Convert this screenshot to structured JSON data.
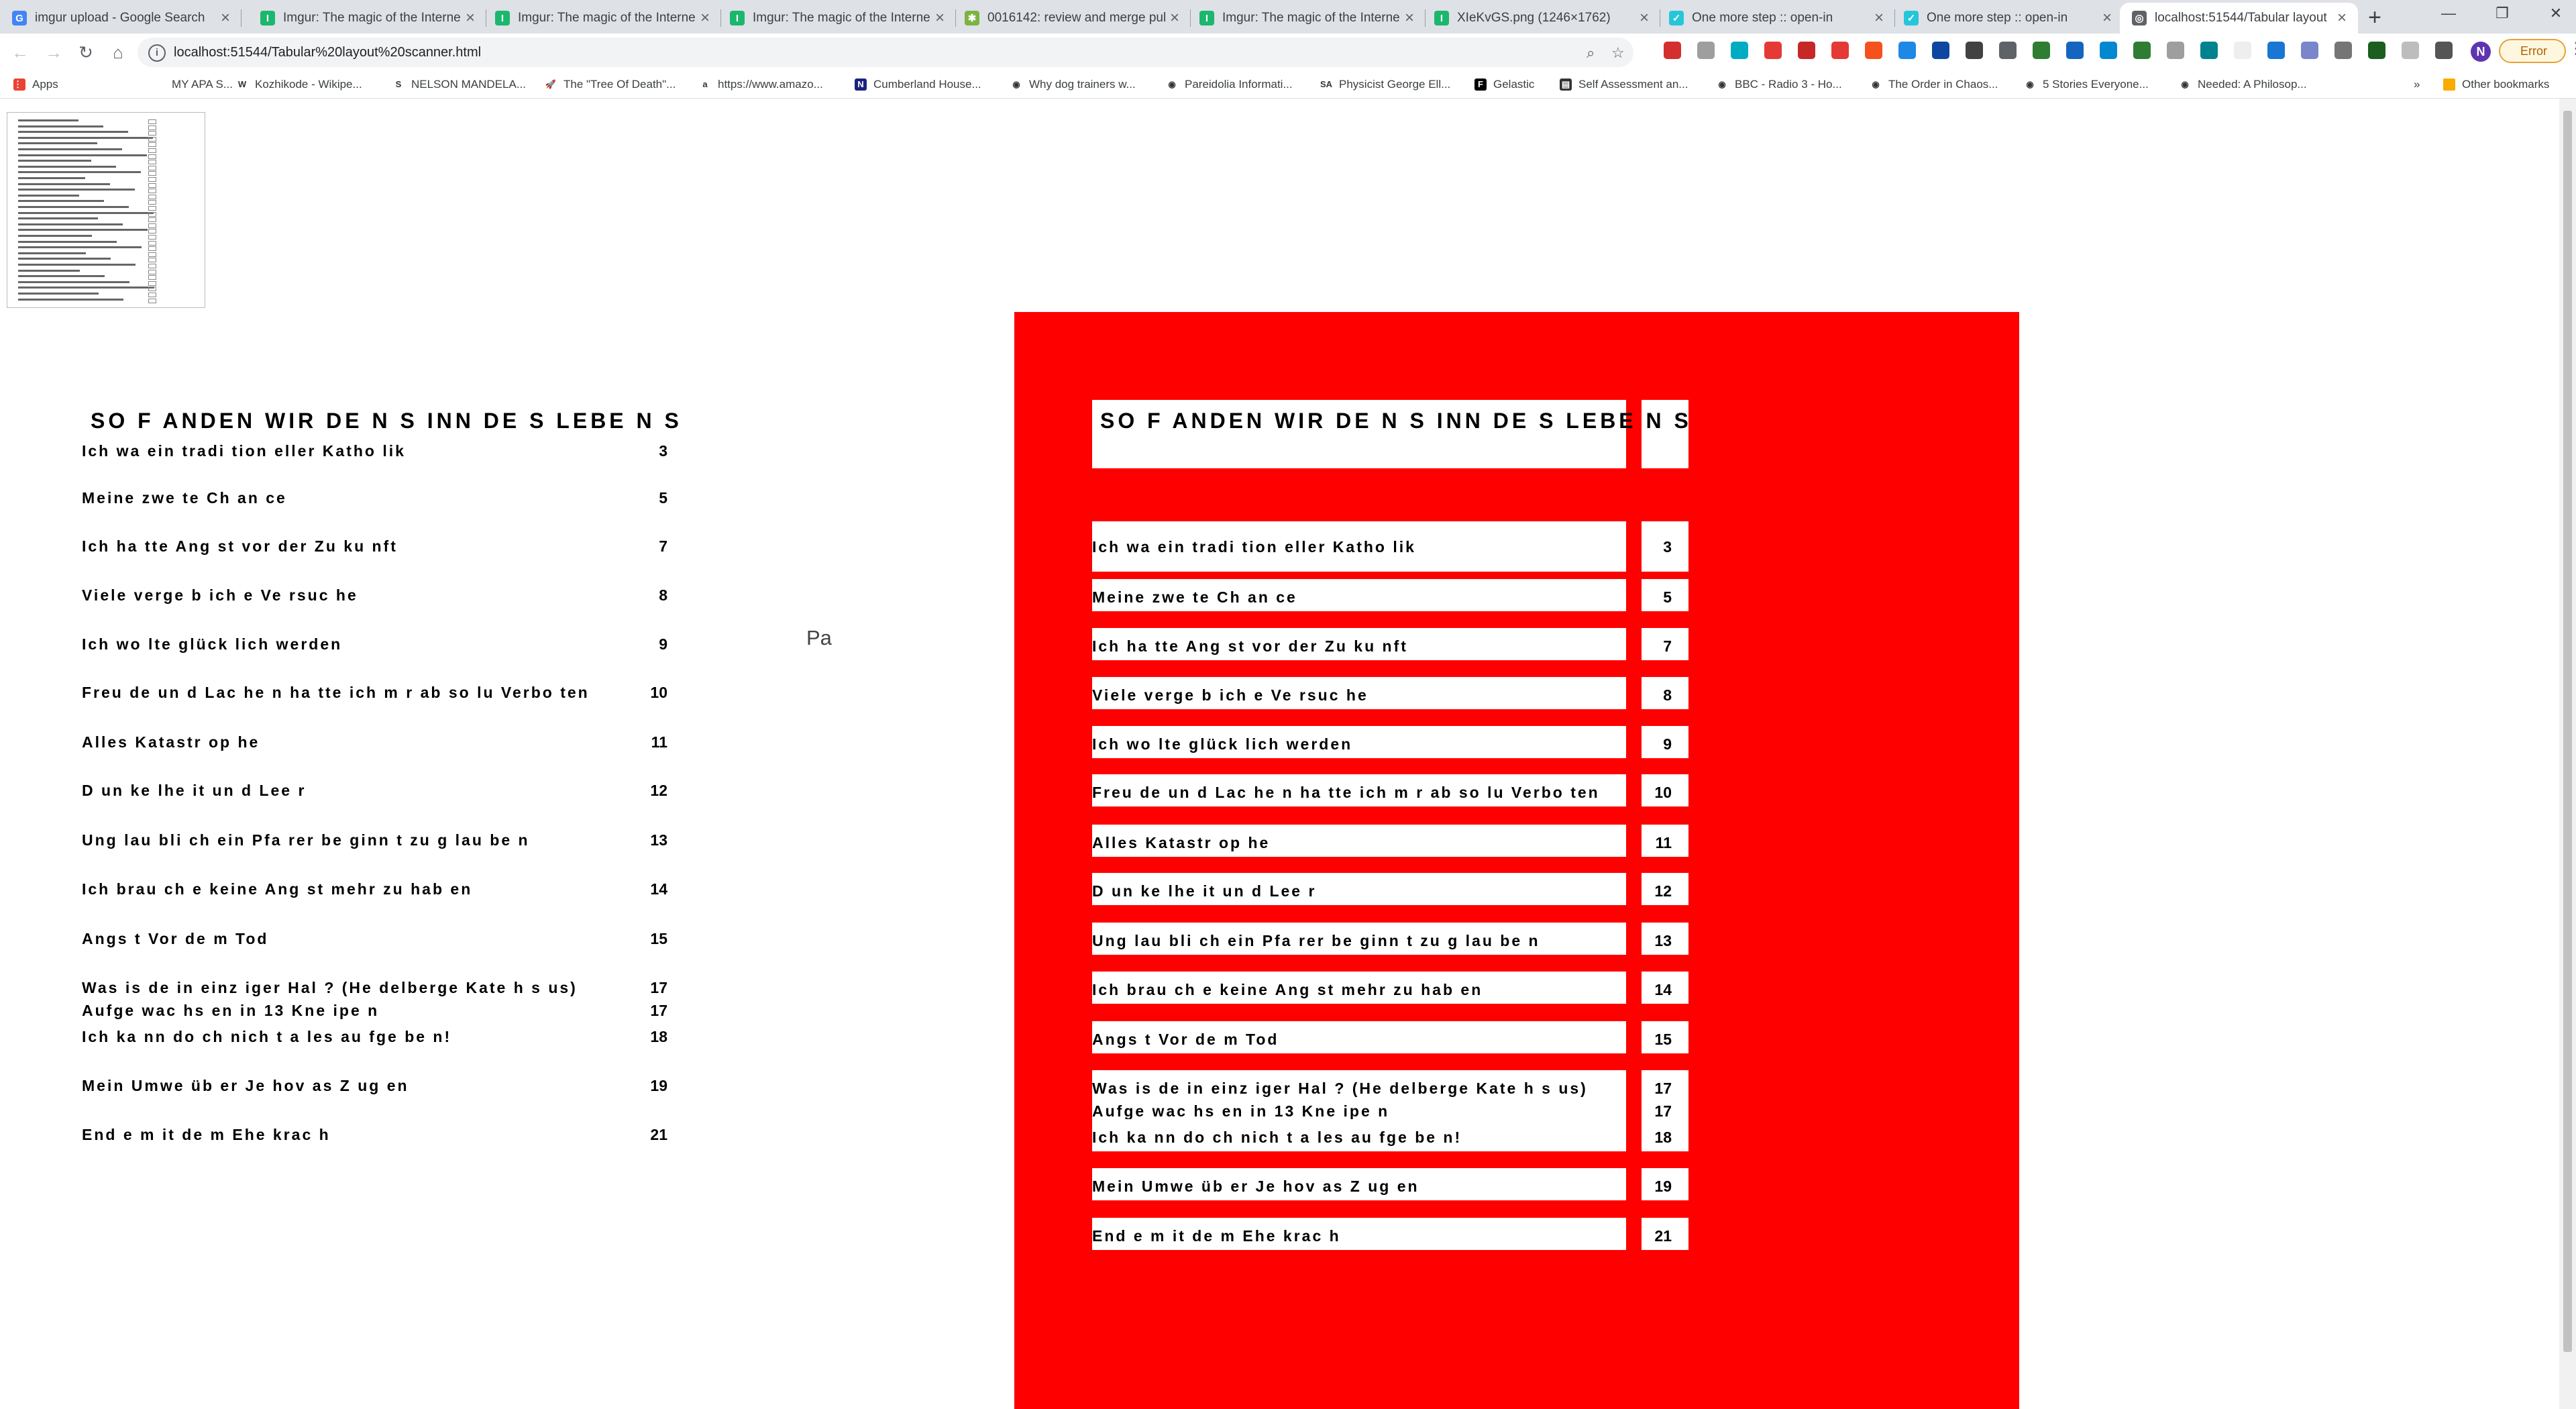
{
  "browser": {
    "tabs": [
      {
        "title": "imgur upload - Google Search",
        "icon": "google-icon",
        "color": "#4285f4",
        "glyph": "G"
      },
      {
        "title": "Imgur: The magic of the Interne",
        "icon": "imgur-icon",
        "color": "#1bb76e",
        "glyph": "I"
      },
      {
        "title": "Imgur: The magic of the Interne",
        "icon": "imgur-icon",
        "color": "#1bb76e",
        "glyph": "I"
      },
      {
        "title": "Imgur: The magic of the Interne",
        "icon": "imgur-icon",
        "color": "#1bb76e",
        "glyph": "I"
      },
      {
        "title": "0016142: review and merge pul",
        "icon": "bug-icon",
        "color": "#7cb342",
        "glyph": "✱"
      },
      {
        "title": "Imgur: The magic of the Interne",
        "icon": "imgur-icon",
        "color": "#1bb76e",
        "glyph": "I"
      },
      {
        "title": "XIeKvGS.png (1246×1762)",
        "icon": "imgur-icon",
        "color": "#1bb76e",
        "glyph": "I"
      },
      {
        "title": "One more step :: open-in",
        "icon": "openin-icon",
        "color": "#26c6da",
        "glyph": "✓"
      },
      {
        "title": "One more step :: open-in",
        "icon": "openin-icon",
        "color": "#26c6da",
        "glyph": "✓"
      },
      {
        "title": "localhost:51544/Tabular layout",
        "icon": "globe-icon",
        "color": "#5f6368",
        "glyph": "◎"
      }
    ],
    "url_host": "localhost:51544",
    "url_path": "/Tabular%20layout%20scanner.html",
    "error_label": "Error",
    "profile_initial": "N",
    "bookmarks": [
      {
        "label": "Apps",
        "icon": "apps-icon",
        "color": "#ea4335",
        "glyph": "⋮⋮"
      },
      {
        "label": "MY APA S...",
        "icon": "bookmark-icon",
        "color": "#ffffff",
        "glyph": ""
      },
      {
        "label": "Kozhikode - Wikipe...",
        "icon": "wikipedia-icon",
        "color": "#ffffff",
        "glyph": "W"
      },
      {
        "label": "NELSON MANDELA...",
        "icon": "bookmark-s-icon",
        "color": "#ffffff",
        "glyph": "S"
      },
      {
        "label": "The \"Tree Of Death\"...",
        "icon": "rocket-icon",
        "color": "#ffffff",
        "glyph": "🚀"
      },
      {
        "label": "https://www.amazo...",
        "icon": "amazon-icon",
        "color": "#ffffff",
        "glyph": "a"
      },
      {
        "label": "Cumberland House...",
        "icon": "news-icon",
        "color": "#1a237e",
        "glyph": "N"
      },
      {
        "label": "Why dog trainers w...",
        "icon": "globe-icon",
        "color": "#ffffff",
        "glyph": "◉"
      },
      {
        "label": "Pareidolia Informati...",
        "icon": "globe-icon",
        "color": "#ffffff",
        "glyph": "◉"
      },
      {
        "label": "Physicist George Ell...",
        "icon": "sa-icon",
        "color": "#ffffff",
        "glyph": "SA"
      },
      {
        "label": "Gelastic",
        "icon": "f-icon",
        "color": "#000000",
        "glyph": "F"
      },
      {
        "label": "Self Assessment an...",
        "icon": "doc-icon",
        "color": "#333333",
        "glyph": "▤"
      },
      {
        "label": "BBC - Radio 3 - Ho...",
        "icon": "bbc-icon",
        "color": "#ffffff",
        "glyph": "◉"
      },
      {
        "label": "The Order in Chaos...",
        "icon": "globe-icon",
        "color": "#ffffff",
        "glyph": "◉"
      },
      {
        "label": "5 Stories Everyone...",
        "icon": "globe-icon",
        "color": "#ffffff",
        "glyph": "◉"
      },
      {
        "label": "Needed: A Philosop...",
        "icon": "globe-icon",
        "color": "#ffffff",
        "glyph": "◉"
      },
      {
        "label": "Other bookmarks",
        "icon": "folder-icon",
        "color": "#f9ab00",
        "glyph": ""
      }
    ],
    "bookmarks_overflow": "»"
  },
  "scanner": {
    "title": "SO F ANDEN WIR  DE N S INN DE  S  LEBE N S",
    "title_right_part": "S",
    "pa_label": "Pa",
    "rows": [
      {
        "text": "Ich  wa   ein  tradi tion eller  Katho lik",
        "num": "3"
      },
      {
        "text": "Meine  zwe te Ch an ce",
        "num": "5"
      },
      {
        "text": "Ich  ha tte  Ang st  vor  der  Zu ku nft",
        "num": "7"
      },
      {
        "text": "Viele  verge b ich e  Ve rsuc he",
        "num": "8"
      },
      {
        "text": "Ich  wo  lte  glück  lich  werden",
        "num": "9"
      },
      {
        "text": "Freu de  un d Lac he n  ha tte  ich  m  r  ab so lu   Verbo ten",
        "num": "10"
      },
      {
        "text": "Alles  Katastr op he",
        "num": "11"
      },
      {
        "text": "D un ke lhe it  un d Lee  r",
        "num": "12"
      },
      {
        "text": "Ung lau bli ch     ein  Pfa  rer  be ginn t zu g lau be n",
        "num": "13"
      },
      {
        "text": "Ich  brau ch e  keine  Ang st  mehr   zu hab  en",
        "num": "14"
      },
      {
        "text": "Angs t Vor  de m  Tod",
        "num": "15"
      },
      {
        "text": "Was   is    de in  einz iger  Hal ? (He delberge   Kate  h s    us)",
        "num": "17",
        "text2": "Aufge wac hs en  in  13  Kne ipe n",
        "num2": "17"
      },
      {
        "text": "Ich  ka nn   do ch  nich t a les  au fge be n!",
        "num": "18"
      },
      {
        "text": "Mein  Umwe     üb er  Je hov as  Z   ug en",
        "num": "19"
      },
      {
        "text": "End e m it de m  Ehe krac h",
        "num": "21"
      }
    ]
  },
  "colors": {
    "canvas_bg": "#ff0000",
    "cell_bg": "#ffffff"
  }
}
